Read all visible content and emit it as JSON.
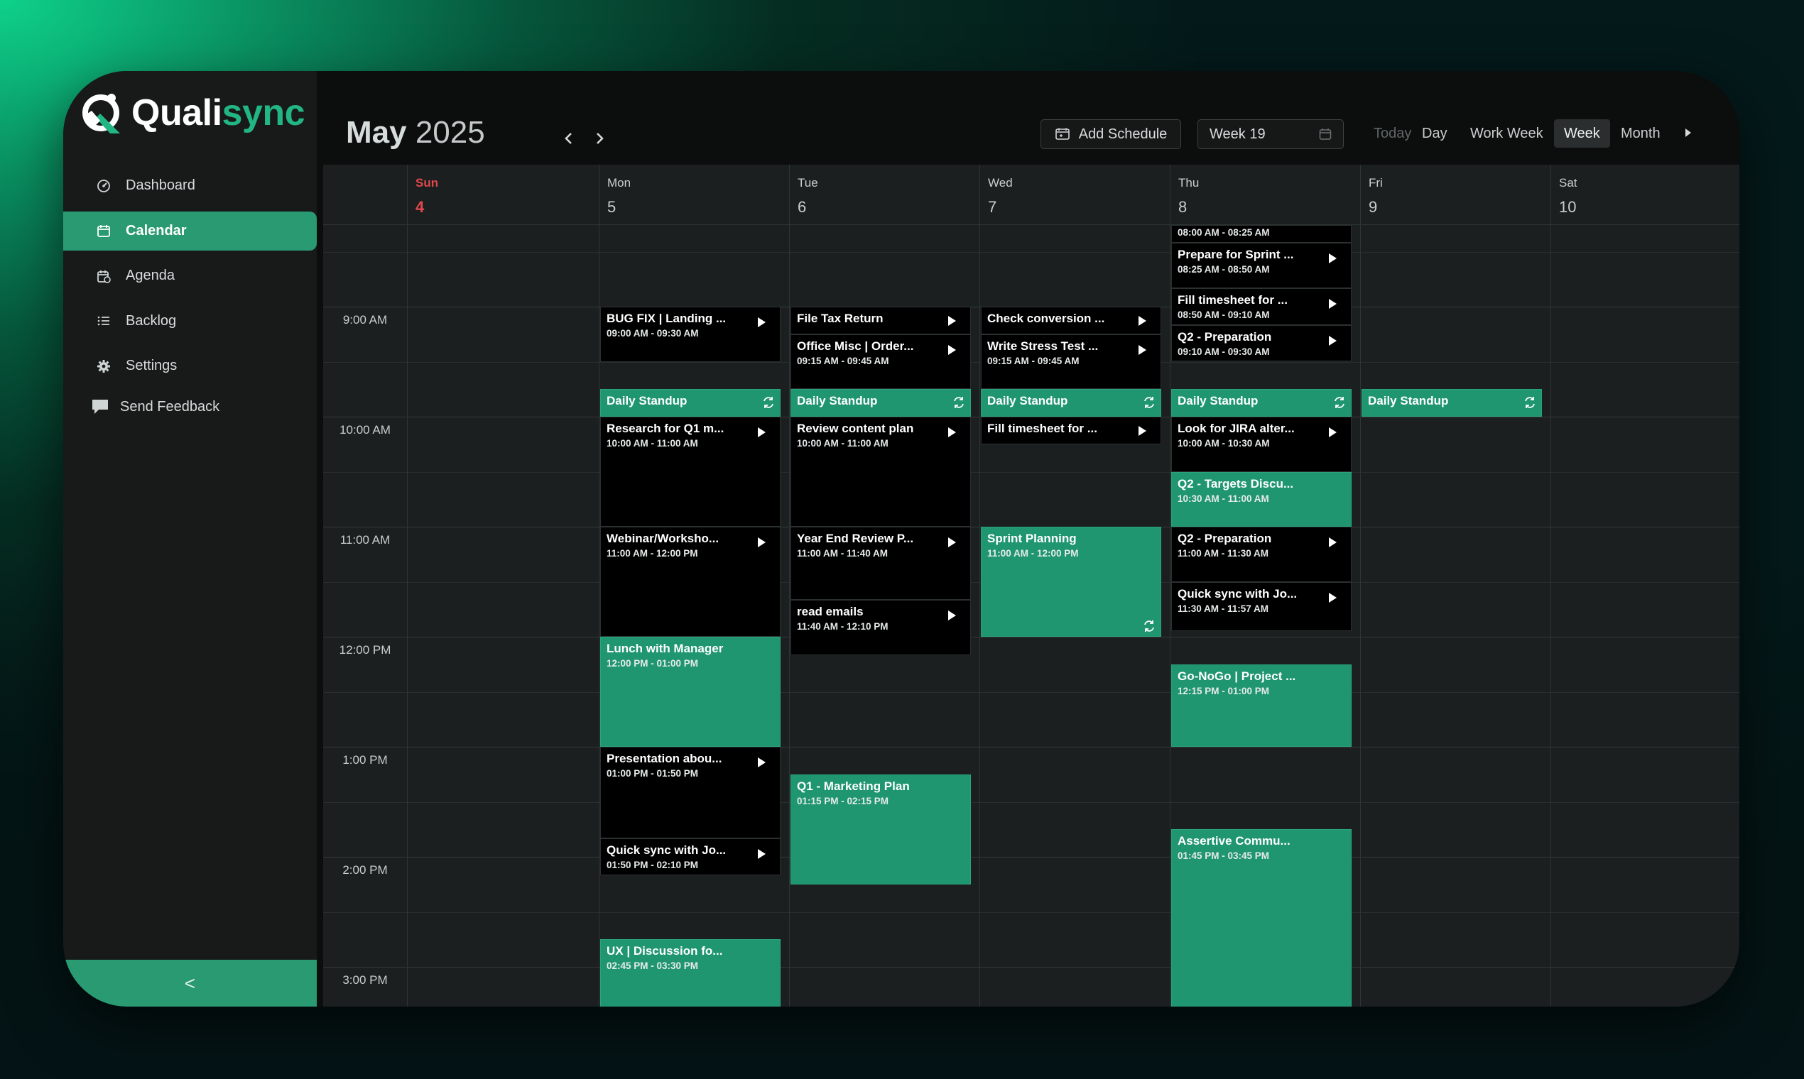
{
  "app": {
    "logo_plain": "Quali",
    "logo_accent": "sync"
  },
  "sidebar": {
    "items": [
      {
        "label": "Dashboard",
        "icon": "gauge-icon",
        "active": false
      },
      {
        "label": "Calendar",
        "icon": "calendar-icon",
        "active": true
      },
      {
        "label": "Agenda",
        "icon": "agenda-icon",
        "active": false
      },
      {
        "label": "Backlog",
        "icon": "list-icon",
        "active": false
      },
      {
        "label": "Settings",
        "icon": "gear-icon",
        "active": false
      }
    ],
    "feedback": "Send Feedback",
    "collapse_glyph": "<"
  },
  "header": {
    "month": "May",
    "year": "2025",
    "add_schedule": "Add Schedule",
    "week_value": "Week 19",
    "views": [
      "Today",
      "Day",
      "Work Week",
      "Week",
      "Month"
    ],
    "selected_view": "Week"
  },
  "days": [
    {
      "name": "Sun",
      "num": "4"
    },
    {
      "name": "Mon",
      "num": "5"
    },
    {
      "name": "Tue",
      "num": "6"
    },
    {
      "name": "Wed",
      "num": "7"
    },
    {
      "name": "Thu",
      "num": "8"
    },
    {
      "name": "Fri",
      "num": "9"
    },
    {
      "name": "Sat",
      "num": "10"
    }
  ],
  "times": [
    "9:00 AM",
    "10:00 AM",
    "11:00 AM",
    "12:00 PM",
    "1:00 PM",
    "2:00 PM",
    "3:00 PM"
  ],
  "events": [
    {
      "day": 4,
      "start": 8.0,
      "end": 8.4167,
      "title": "",
      "time": "08:00 AM - 08:25 AM",
      "style": "dark",
      "play": false,
      "rep": false
    },
    {
      "day": 4,
      "start": 8.4167,
      "end": 8.8333,
      "title": "Prepare for Sprint ...",
      "time": "08:25 AM - 08:50 AM",
      "style": "dark",
      "play": true,
      "rep": false
    },
    {
      "day": 4,
      "start": 8.8333,
      "end": 9.1667,
      "title": "Fill timesheet for ...",
      "time": "08:50 AM - 09:10 AM",
      "style": "dark",
      "play": true,
      "rep": false
    },
    {
      "day": 4,
      "start": 9.1667,
      "end": 9.5,
      "title": "Q2 - Preparation",
      "time": "09:10 AM - 09:30 AM",
      "style": "dark",
      "play": true,
      "rep": false
    },
    {
      "day": 1,
      "start": 9.0,
      "end": 9.5,
      "title": "BUG FIX | Landing ...",
      "time": "09:00 AM - 09:30 AM",
      "style": "dark",
      "play": true,
      "rep": false
    },
    {
      "day": 2,
      "start": 9.0,
      "end": 9.25,
      "title": "File Tax Return",
      "time": "",
      "style": "dark",
      "play": true,
      "rep": false
    },
    {
      "day": 2,
      "start": 9.25,
      "end": 9.75,
      "title": "Office Misc | Order...",
      "time": "09:15 AM - 09:45 AM",
      "style": "dark",
      "play": true,
      "rep": false
    },
    {
      "day": 3,
      "start": 9.0,
      "end": 9.25,
      "title": "Check conversion ...",
      "time": "",
      "style": "dark",
      "play": true,
      "rep": false
    },
    {
      "day": 3,
      "start": 9.25,
      "end": 9.75,
      "title": "Write Stress Test ...",
      "time": "09:15 AM - 09:45 AM",
      "style": "dark",
      "play": true,
      "rep": false
    },
    {
      "day": 1,
      "start": 9.75,
      "end": 10.0,
      "title": "Daily Standup",
      "time": "",
      "style": "green",
      "play": false,
      "rep": true
    },
    {
      "day": 2,
      "start": 9.75,
      "end": 10.0,
      "title": "Daily Standup",
      "time": "",
      "style": "green",
      "play": false,
      "rep": true
    },
    {
      "day": 3,
      "start": 9.75,
      "end": 10.0,
      "title": "Daily Standup",
      "time": "",
      "style": "green",
      "play": false,
      "rep": true
    },
    {
      "day": 4,
      "start": 9.75,
      "end": 10.0,
      "title": "Daily Standup",
      "time": "",
      "style": "green",
      "play": false,
      "rep": true
    },
    {
      "day": 5,
      "start": 9.75,
      "end": 10.0,
      "title": "Daily Standup",
      "time": "",
      "style": "green",
      "play": false,
      "rep": true
    },
    {
      "day": 1,
      "start": 10.0,
      "end": 11.0,
      "title": "Research for Q1 m...",
      "time": "10:00 AM - 11:00 AM",
      "style": "dark",
      "play": true,
      "rep": false
    },
    {
      "day": 2,
      "start": 10.0,
      "end": 11.0,
      "title": "Review content plan",
      "time": "10:00 AM - 11:00 AM",
      "style": "dark",
      "play": true,
      "rep": false
    },
    {
      "day": 3,
      "start": 10.0,
      "end": 10.25,
      "title": "Fill timesheet for ...",
      "time": "",
      "style": "dark",
      "play": true,
      "rep": false
    },
    {
      "day": 4,
      "start": 10.0,
      "end": 10.5,
      "title": "Look for JIRA alter...",
      "time": "10:00 AM - 10:30 AM",
      "style": "dark",
      "play": true,
      "rep": false
    },
    {
      "day": 4,
      "start": 10.5,
      "end": 11.0,
      "title": "Q2 - Targets Discu...",
      "time": "10:30 AM - 11:00 AM",
      "style": "green",
      "play": false,
      "rep": false
    },
    {
      "day": 1,
      "start": 11.0,
      "end": 12.0,
      "title": "Webinar/Worksho...",
      "time": "11:00 AM - 12:00 PM",
      "style": "dark",
      "play": true,
      "rep": false
    },
    {
      "day": 2,
      "start": 11.0,
      "end": 11.6667,
      "title": "Year End Review P...",
      "time": "11:00 AM - 11:40 AM",
      "style": "dark",
      "play": true,
      "rep": false
    },
    {
      "day": 2,
      "start": 11.6667,
      "end": 12.1667,
      "title": "read emails",
      "time": "11:40 AM - 12:10 PM",
      "style": "dark",
      "play": true,
      "rep": false
    },
    {
      "day": 3,
      "start": 11.0,
      "end": 12.0,
      "title": "Sprint Planning",
      "time": "11:00 AM - 12:00 PM",
      "style": "green",
      "play": false,
      "rep": true
    },
    {
      "day": 4,
      "start": 11.0,
      "end": 11.5,
      "title": "Q2 - Preparation",
      "time": "11:00 AM - 11:30 AM",
      "style": "dark",
      "play": true,
      "rep": false
    },
    {
      "day": 4,
      "start": 11.5,
      "end": 11.95,
      "title": "Quick sync with Jo...",
      "time": "11:30 AM - 11:57 AM",
      "style": "dark",
      "play": true,
      "rep": false
    },
    {
      "day": 1,
      "start": 12.0,
      "end": 13.0,
      "title": "Lunch with Manager",
      "time": "12:00 PM - 01:00 PM",
      "style": "green",
      "play": false,
      "rep": false
    },
    {
      "day": 4,
      "start": 12.25,
      "end": 13.0,
      "title": "Go-NoGo | Project ...",
      "time": "12:15 PM - 01:00 PM",
      "style": "green",
      "play": false,
      "rep": false
    },
    {
      "day": 1,
      "start": 13.0,
      "end": 13.8333,
      "title": "Presentation abou...",
      "time": "01:00 PM - 01:50 PM",
      "style": "dark",
      "play": true,
      "rep": false
    },
    {
      "day": 1,
      "start": 13.8333,
      "end": 14.1667,
      "title": "Quick sync with Jo...",
      "time": "01:50 PM - 02:10 PM",
      "style": "dark",
      "play": true,
      "rep": false
    },
    {
      "day": 2,
      "start": 13.25,
      "end": 14.25,
      "title": "Q1 - Marketing Plan",
      "time": "01:15 PM - 02:15 PM",
      "style": "green",
      "play": false,
      "rep": false
    },
    {
      "day": 4,
      "start": 13.75,
      "end": 15.75,
      "title": "Assertive Commu...",
      "time": "01:45 PM - 03:45 PM",
      "style": "green",
      "play": false,
      "rep": false
    },
    {
      "day": 1,
      "start": 14.75,
      "end": 15.5,
      "title": "UX | Discussion fo...",
      "time": "02:45 PM - 03:30 PM",
      "style": "green",
      "play": false,
      "rep": false
    }
  ],
  "colors": {
    "accent": "#1f9670",
    "accent_light": "#22b684",
    "sunday": "#e0484d",
    "event_dark": "#000000"
  }
}
